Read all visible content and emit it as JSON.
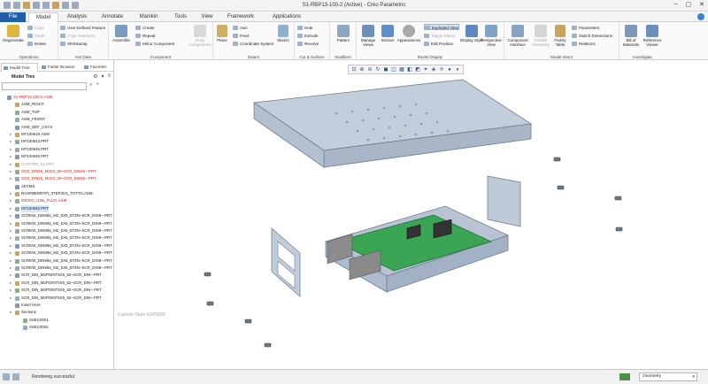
{
  "window": {
    "title": "S1-RBP13-100-2 (Active) - Creo Parametric"
  },
  "tabs": [
    "File",
    "Model",
    "Analysis",
    "Annotate",
    "Manikin",
    "Tools",
    "View",
    "Framework",
    "Applications"
  ],
  "active_tab": "Model",
  "ribbon": {
    "operations": {
      "label": "Operations",
      "regenerate": "Regenerate",
      "copy": "Copy",
      "paste": "Paste",
      "delete": "Delete"
    },
    "get_data": {
      "label": "Get Data",
      "udf": "User-Defined Feature",
      "copy_geometry": "Copy Geometry",
      "shrinkwrap": "Shrinkwrap"
    },
    "component": {
      "label": "Component",
      "assemble": "Assemble",
      "create": "Create",
      "repeat": "Repeat",
      "mirror": "Mirror Component",
      "drag": "Drag Components"
    },
    "datum": {
      "label": "Datum",
      "plane": "Plane",
      "axis": "Axis",
      "point": "Point",
      "csys": "Coordinate System",
      "sketch": "Sketch"
    },
    "cut_surface": {
      "label": "Cut & Surface",
      "hole": "Hole",
      "extrude": "Extrude",
      "revolve": "Revolve"
    },
    "modifiers": {
      "label": "Modifiers",
      "pattern": "Pattern"
    },
    "model_display": {
      "label": "Model Display",
      "manage_views": "Manage Views",
      "section": "Section",
      "appearances": "Appearances",
      "exploded_view": "Exploded View",
      "toggle_status": "Toggle Status",
      "edit_position": "Edit Position",
      "display_style": "Display Style",
      "perspective_view": "Perspective View"
    },
    "model_intent": {
      "label": "Model Intent",
      "component_interface": "Component Interface",
      "publish_geometry": "Publish Geometry",
      "family_table": "Family Table",
      "parameters": "Parameters",
      "switch_dimensions": "Switch Dimensions",
      "relations": "Relations"
    },
    "investigate": {
      "label": "Investigate",
      "bom": "Bill of Materials",
      "reference_viewer": "Reference Viewer"
    }
  },
  "tree_tabs": [
    "Model Tree",
    "Folder Browser",
    "Favorites"
  ],
  "tree_header": "Model Tree",
  "tree_items": [
    {
      "text": "S1-RBP13-100-2.ASM",
      "style": "red",
      "indent": 0,
      "exp": ""
    },
    {
      "text": "ASM_RIGHT",
      "style": "",
      "indent": 1,
      "exp": ""
    },
    {
      "text": "ASM_TOP",
      "style": "",
      "indent": 1,
      "exp": ""
    },
    {
      "text": "ASM_FRONT",
      "style": "",
      "indent": 1,
      "exp": ""
    },
    {
      "text": "ASM_DEF_CSYS",
      "style": "",
      "indent": 1,
      "exp": ""
    },
    {
      "text": "MT100619.ASM",
      "style": "",
      "indent": 1,
      "exp": "▸"
    },
    {
      "text": "MT100643.PRT",
      "style": "",
      "indent": 1,
      "exp": "▸"
    },
    {
      "text": "MT100645.PRT",
      "style": "",
      "indent": 1,
      "exp": "▸"
    },
    {
      "text": "MT100646.PRT",
      "style": "",
      "indent": 1,
      "exp": "▸"
    },
    {
      "text": "CUSTOM_S1.PRT",
      "style": "gray",
      "indent": 1,
      "exp": "▸"
    },
    {
      "text": "SCR_DIN65_M3X3_55~SCR_DIN65~.PRT",
      "style": "red",
      "indent": 1,
      "exp": "▸"
    },
    {
      "text": "SCR_DIN65_M3X3_55~SCR_DIN65~.PRT",
      "style": "red",
      "indent": 1,
      "exp": "▸"
    },
    {
      "text": "ADTMS",
      "style": "",
      "indent": 1,
      "exp": ""
    },
    {
      "text": "RASPBERRYPI_3TEP3C6_TOTTO.ASM",
      "style": "",
      "indent": 1,
      "exp": "▸"
    },
    {
      "text": "MICRO_USB_PLUG.ASM",
      "style": "red",
      "indent": 1,
      "exp": "▸"
    },
    {
      "text": "MT100652.PRT",
      "style": "sel",
      "indent": 1,
      "exp": "▸"
    },
    {
      "text": "SCREW_DIN965_M2_5X5_5TZN~SCR_DIN9~.PRT",
      "style": "",
      "indent": 1,
      "exp": "▸"
    },
    {
      "text": "SCREW_DIN965_M2_5X5_5TZN~SCR_DIN9~.PRT",
      "style": "",
      "indent": 1,
      "exp": "▸"
    },
    {
      "text": "SCREW_DIN965_M2_5X5_5TZN~SCR_DIN9~.PRT",
      "style": "",
      "indent": 1,
      "exp": "▸"
    },
    {
      "text": "SCREW_DIN965_M2_5X5_5TZN~SCR_DIN9~.PRT",
      "style": "",
      "indent": 1,
      "exp": "▸"
    },
    {
      "text": "SCREW_DIN965_M2_5X5_5TZN~SCR_DIN9~.PRT",
      "style": "",
      "indent": 1,
      "exp": "▸"
    },
    {
      "text": "SCREW_DIN965_M2_5X5_5TZN~SCR_DIN9~.PRT",
      "style": "",
      "indent": 1,
      "exp": "▸"
    },
    {
      "text": "SCREW_DIN965_M2_5X5_5TZN~SCR_DIN9~.PRT",
      "style": "",
      "indent": 1,
      "exp": "▸"
    },
    {
      "text": "SCREW_DIN965_M2_5X5_5TZN~SCR_DIN9~.PRT",
      "style": "",
      "indent": 1,
      "exp": "▸"
    },
    {
      "text": "SCR_DIN_M2POINT5X5_52~SCR_DIN~.PRT",
      "style": "",
      "indent": 1,
      "exp": "▸"
    },
    {
      "text": "SCR_DIN_M2POINT5X5_52~SCR_DIN~.PRT",
      "style": "",
      "indent": 1,
      "exp": "▸"
    },
    {
      "text": "SCR_DIN_M2POINT5X5_52~SCR_DIN~.PRT",
      "style": "",
      "indent": 1,
      "exp": "▸"
    },
    {
      "text": "SCR_DIN_M2POINT5X5_52~SCR_DIN~.PRT",
      "style": "",
      "indent": 1,
      "exp": "▸"
    },
    {
      "text": "Insert Here",
      "style": "",
      "indent": 1,
      "exp": ""
    },
    {
      "text": "Sections",
      "style": "",
      "indent": 1,
      "exp": "▾"
    },
    {
      "text": "XSEC0001",
      "style": "",
      "indent": 2,
      "exp": ""
    },
    {
      "text": "XSEC0002",
      "style": "",
      "indent": 2,
      "exp": ""
    }
  ],
  "canvas": {
    "watermark": "Explode State EXP0000"
  },
  "status": {
    "message": "Rendering successful.",
    "filter": "Geometry"
  }
}
